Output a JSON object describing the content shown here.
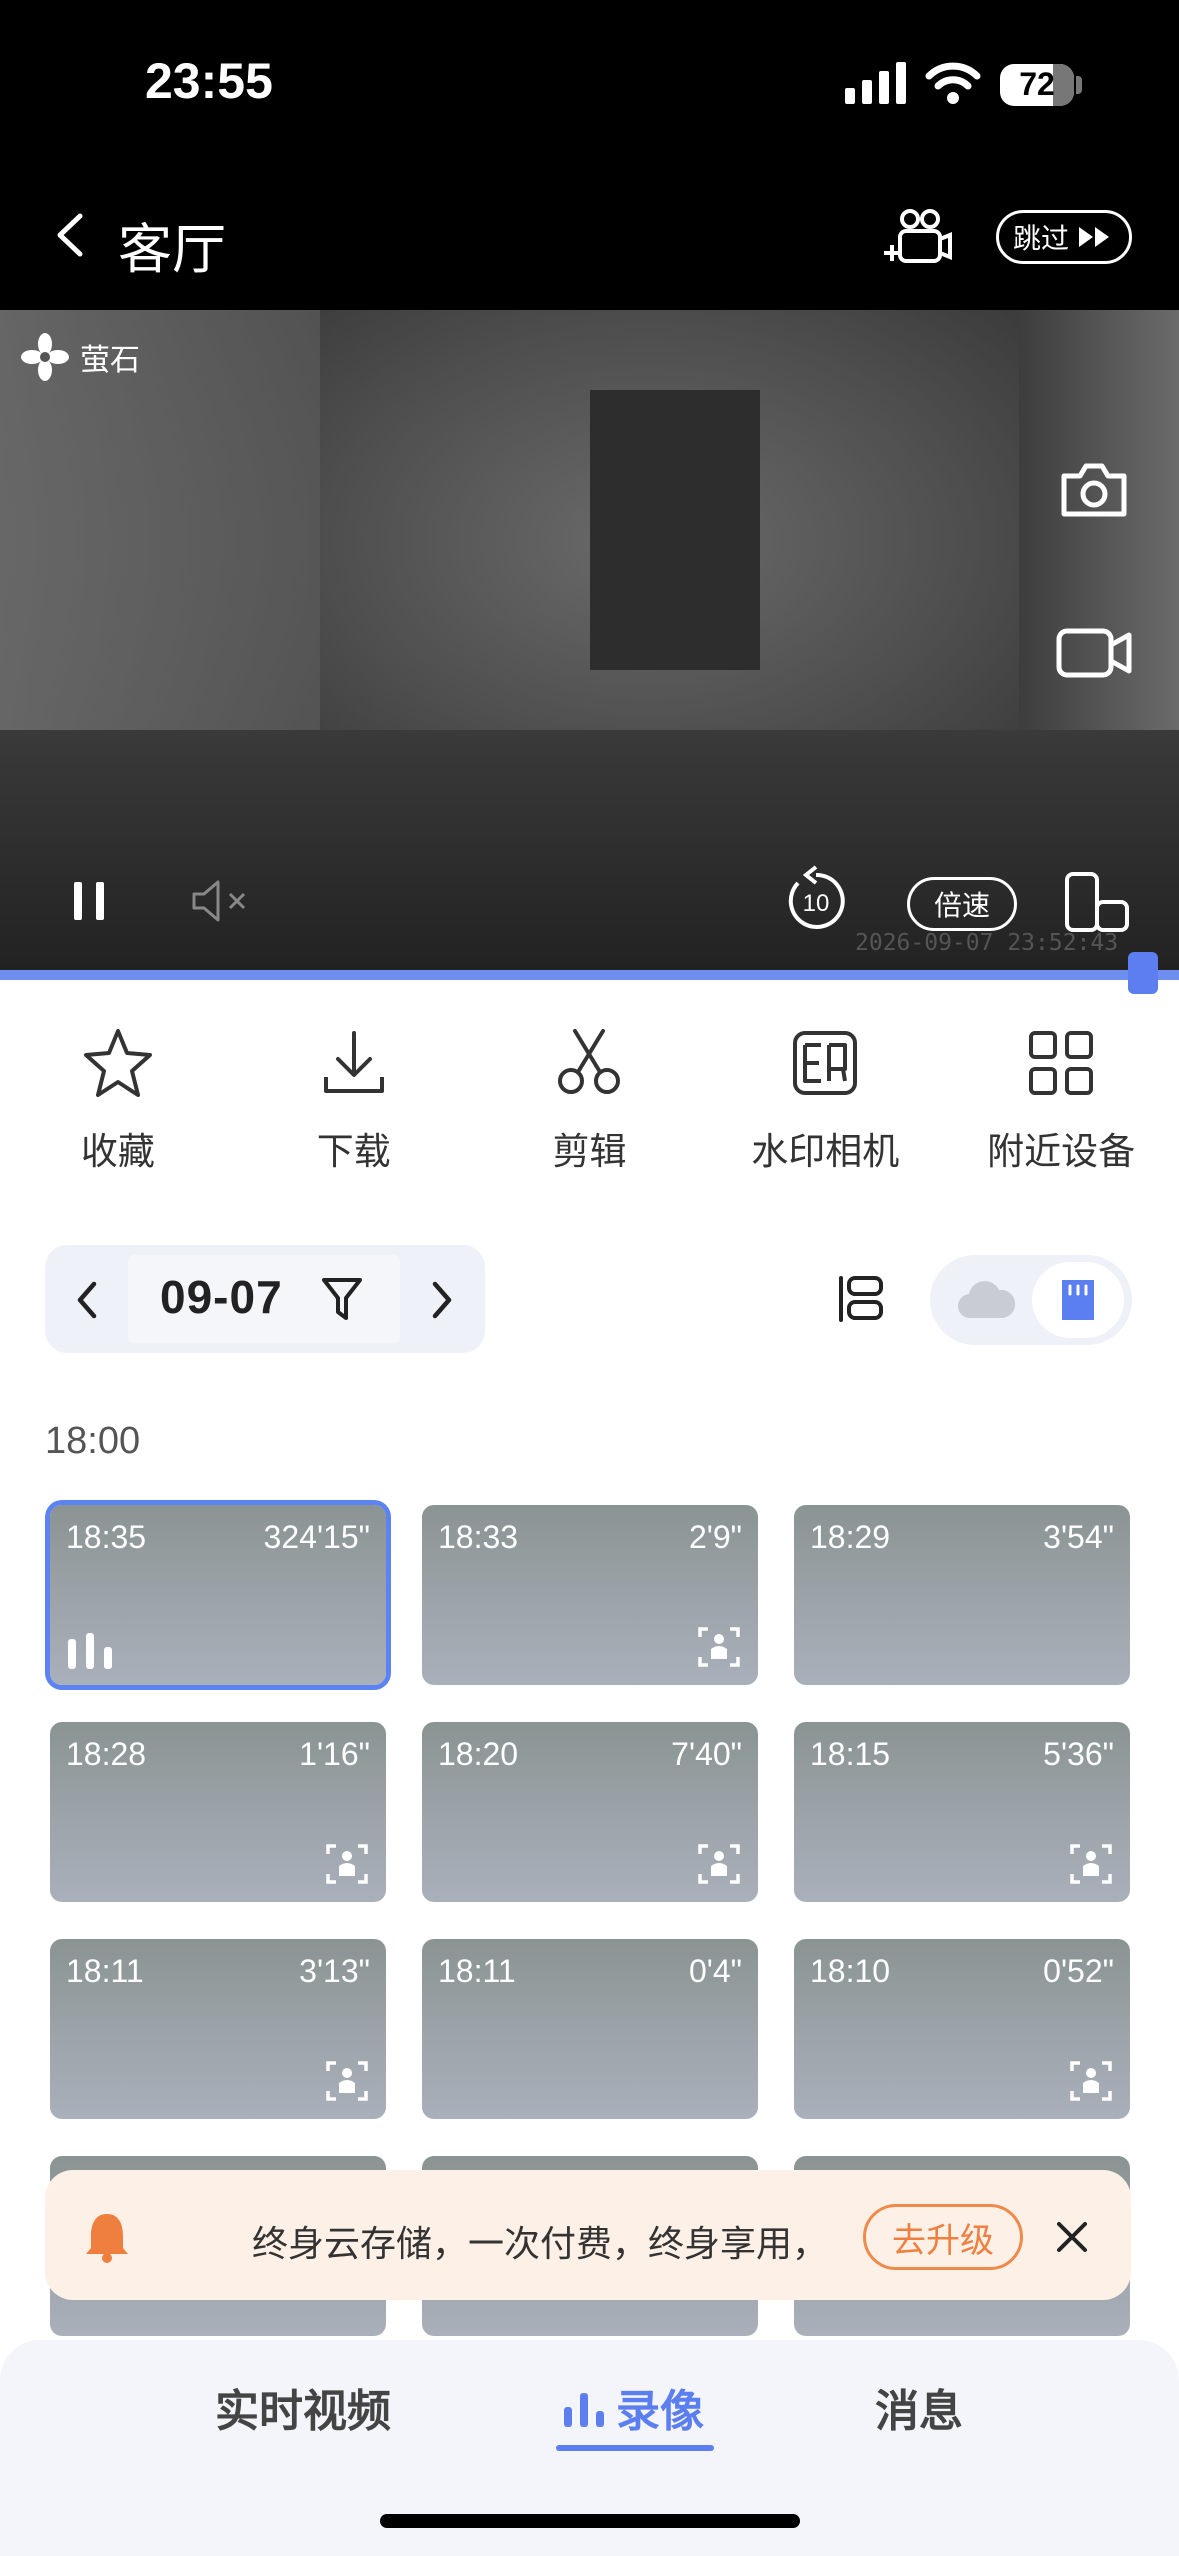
{
  "status_bar": {
    "time": "23:55",
    "battery": "72"
  },
  "header": {
    "title": "客厅",
    "skip_label": "跳过"
  },
  "video": {
    "brand": "萤石",
    "speed_label": "倍速",
    "replay_seconds": "10",
    "timestamp": "2026-09-07 23:52:43",
    "progress": 0.97
  },
  "actions": [
    {
      "label": "收藏",
      "icon": "star-icon"
    },
    {
      "label": "下载",
      "icon": "download-icon"
    },
    {
      "label": "剪辑",
      "icon": "scissors-icon"
    },
    {
      "label": "水印相机",
      "icon": "watermark-camera-icon"
    },
    {
      "label": "附近设备",
      "icon": "grid-icon"
    }
  ],
  "date_nav": {
    "date": "09-07"
  },
  "section": {
    "time": "18:00"
  },
  "clips": [
    {
      "time": "18:35",
      "duration": "324'15\"",
      "selected": true,
      "badge": "playing"
    },
    {
      "time": "18:33",
      "duration": "2'9\"",
      "badge": "person"
    },
    {
      "time": "18:29",
      "duration": "3'54\"",
      "badge": "none"
    },
    {
      "time": "18:28",
      "duration": "1'16\"",
      "badge": "person"
    },
    {
      "time": "18:20",
      "duration": "7'40\"",
      "badge": "person"
    },
    {
      "time": "18:15",
      "duration": "5'36\"",
      "badge": "person"
    },
    {
      "time": "18:11",
      "duration": "3'13\"",
      "badge": "person"
    },
    {
      "time": "18:11",
      "duration": "0'4\"",
      "badge": "none"
    },
    {
      "time": "18:10",
      "duration": "0'52\"",
      "badge": "person"
    }
  ],
  "banner": {
    "text": "终身云存储，一次付费，终身享用，",
    "button": "去升级"
  },
  "tabs": {
    "live": "实时视频",
    "recording": "录像",
    "messages": "消息"
  },
  "colors": {
    "accent": "#5b7ff0",
    "promo": "#ef7f3e"
  }
}
